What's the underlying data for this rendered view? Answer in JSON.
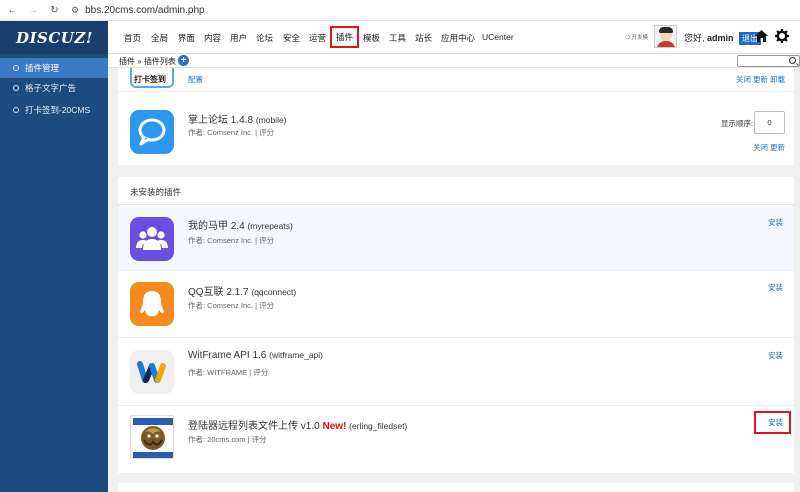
{
  "browser": {
    "url": "bbs.20cms.com/admin.php"
  },
  "brand": {
    "logo": "DISCUZ!"
  },
  "sidebar": {
    "items": [
      {
        "label": "插件管理",
        "active": true
      },
      {
        "label": "格子文字广告",
        "active": false
      },
      {
        "label": "打卡签到-20CMS",
        "active": false
      }
    ]
  },
  "topnav": {
    "items": [
      "首页",
      "全局",
      "界面",
      "内容",
      "用户",
      "论坛",
      "安全",
      "运营",
      "插件",
      "模板",
      "工具",
      "站长",
      "应用中心",
      "UCenter"
    ],
    "active": "插件",
    "dev_mode": "开发模",
    "greeting": "您好, ",
    "username": "admin",
    "logout": "退出"
  },
  "breadcrumb": {
    "text": "插件 » 插件列表"
  },
  "installed_plugins": [
    {
      "name": "",
      "author": "",
      "banner": "打卡签到",
      "actions": [
        "配置"
      ],
      "right_actions": [
        "关闭",
        "更新",
        "卸载"
      ]
    },
    {
      "name": "掌上论坛 1.4.8",
      "id": "(mobile)",
      "author": "作者: Comsenz Inc. | 评分",
      "order_label": "显示顺序:",
      "order_value": "0",
      "right_actions": [
        "关闭",
        "更新"
      ]
    }
  ],
  "uninstalled_section": {
    "title": "未安装的插件",
    "plugins": [
      {
        "name": "我的马甲 2.4",
        "id": "(myrepeats)",
        "author": "作者: Comsenz Inc. | 评分",
        "action": "安装",
        "icon": "users-icon",
        "color": "#6a4fe0"
      },
      {
        "name": "QQ互联 2.1.7",
        "id": "(qqconnect)",
        "author": "作者: Comsenz Inc. | 评分",
        "action": "安装",
        "icon": "qq-icon",
        "color": "#f58a1f"
      },
      {
        "name": "WitFrame API 1.6",
        "id": "(witframe_api)",
        "author": "作者: WITFRAME | 评分",
        "action": "安装",
        "icon": "witframe-icon",
        "color": "#f2f2f2"
      },
      {
        "name": "登陆器远程列表文件上传 v1.0",
        "new": "New!",
        "id": "(erling_filedset)",
        "author": "作者: 20cms.com | 评分",
        "action": "安装",
        "icon": "dragon-icon",
        "color": "#ffffff"
      }
    ]
  }
}
